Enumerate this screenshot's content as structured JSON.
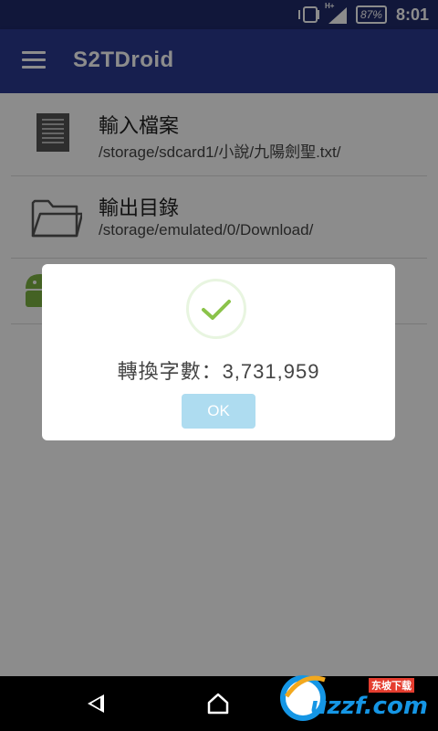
{
  "status_bar": {
    "network_type": "H+",
    "battery": "87%",
    "time": "8:01"
  },
  "app_bar": {
    "title": "S2TDroid"
  },
  "list": {
    "items": [
      {
        "title": "輸入檔案",
        "subtitle": "/storage/sdcard1/小說/九陽劍聖.txt/",
        "icon": "document-icon"
      },
      {
        "title": "輸出目錄",
        "subtitle": "/storage/emulated/0/Download/",
        "icon": "folder-icon"
      },
      {
        "title": "",
        "subtitle": "",
        "icon": "android-icon"
      }
    ]
  },
  "dialog": {
    "message": "轉換字數：3,731,959",
    "ok_label": "OK"
  },
  "nav_bar": {
    "back_icon": "back-icon",
    "home_icon": "home-icon"
  },
  "watermark": {
    "text": "uzzf.com",
    "top_text": "东坡下载"
  },
  "colors": {
    "status_bar": "#1f2a6b",
    "app_bar": "#2a3990",
    "ok_button": "#aedcf0",
    "check": "#8bc34a"
  }
}
